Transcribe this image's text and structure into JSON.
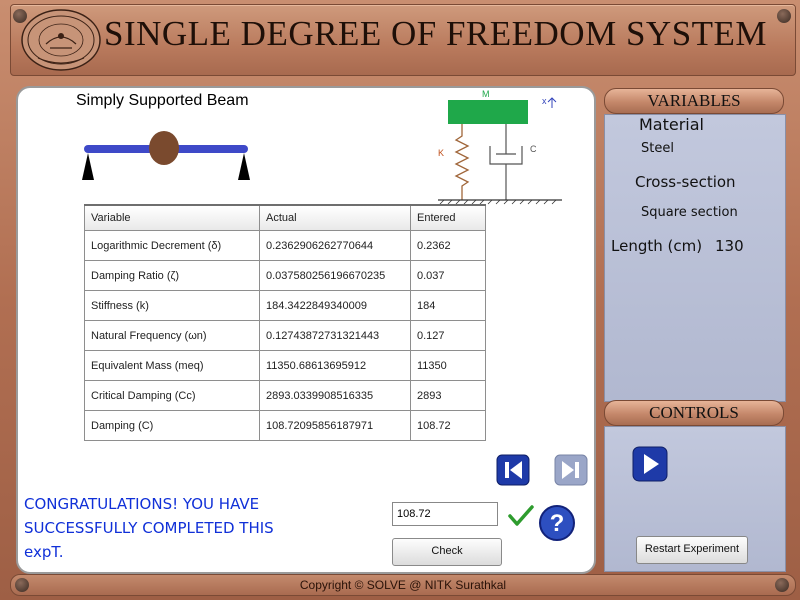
{
  "header": {
    "title": "SINGLE DEGREE OF FREEDOM SYSTEM",
    "logo_icon": "nitk-seal-logo"
  },
  "main": {
    "beam_title": "Simply Supported Beam",
    "diagram": {
      "mass_label": "M",
      "spring_label": "K",
      "damper_label": "C",
      "axis_label": "x"
    },
    "table": {
      "headers": [
        "Variable",
        "Actual",
        "Entered"
      ],
      "rows": [
        [
          "Logarithmic Decrement (δ)",
          "0.2362906262770644",
          "0.2362"
        ],
        [
          "Damping Ratio (ζ)",
          "0.037580256196670235",
          "0.037"
        ],
        [
          "Stiffness (k)",
          "184.3422849340009",
          "184"
        ],
        [
          "Natural Frequency (ωn)",
          "0.12743872731321443",
          "0.127"
        ],
        [
          "Equivalent Mass (meq)",
          "11350.68613695912",
          "11350"
        ],
        [
          "Critical Damping (Cc)",
          "2893.0339908516335",
          "2893"
        ],
        [
          "Damping (C)",
          "108.72095856187971",
          "108.72"
        ]
      ]
    },
    "congrats_line1": "CONGRATULATIONS! YOU HAVE",
    "congrats_line2": "SUCCESSFULLY COMPLETED THIS expT.",
    "entry_value": "108.72",
    "check_label": "Check",
    "icons": {
      "prev": "skip-back-icon",
      "next": "skip-forward-icon",
      "tick": "check-mark-icon",
      "help": "help-question-icon"
    }
  },
  "variables": {
    "heading": "VARIABLES",
    "material_label": "Material",
    "material_value": "Steel",
    "cross_section_label": "Cross-section",
    "cross_section_value": "Square section",
    "length_label": "Length (cm)",
    "length_value": "130"
  },
  "controls": {
    "heading": "CONTROLS",
    "play_icon": "play-icon",
    "restart_label": "Restart Experiment"
  },
  "footer": {
    "copyright": "Copyright © SOLVE @ NITK Surathkal"
  },
  "colors": {
    "frame": "#b9785c",
    "congrats_text": "#1030d8",
    "beam": "#3e49c8",
    "mass_block": "#1fa84a",
    "button_blue": "#1e3aa8",
    "side_panel": "#b9bfd6"
  }
}
